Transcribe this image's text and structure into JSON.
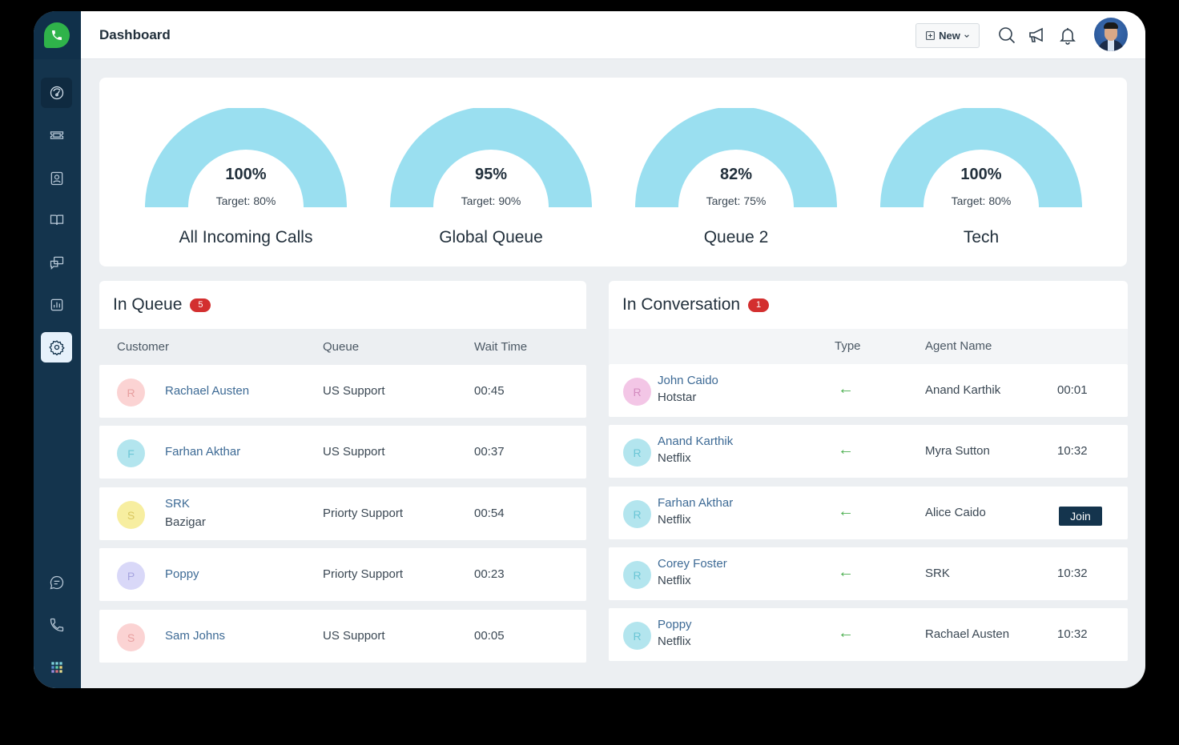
{
  "app": {
    "title": "Dashboard"
  },
  "colors": {
    "sidebar": "#14344d",
    "gauge_fill": "#9adff0",
    "badge": "#d32f2f",
    "accent_green": "#2fb34a",
    "link_text": "#3d6a95"
  },
  "sidebar": {
    "logo_icon": "phone-icon",
    "items": [
      {
        "id": "dashboard",
        "icon": "speedometer-icon",
        "active": "dark"
      },
      {
        "id": "tickets",
        "icon": "ticket-icon"
      },
      {
        "id": "contacts",
        "icon": "contact-card-icon"
      },
      {
        "id": "knowledge-base",
        "icon": "book-icon"
      },
      {
        "id": "conversations",
        "icon": "chat-windows-icon"
      },
      {
        "id": "reports",
        "icon": "bar-chart-icon"
      },
      {
        "id": "settings",
        "icon": "gear-icon",
        "active": "light"
      }
    ],
    "bottom_items": [
      {
        "id": "chat",
        "icon": "chat-bubble-icon"
      },
      {
        "id": "phone",
        "icon": "phone-icon"
      },
      {
        "id": "apps",
        "icon": "app-grid-icon"
      }
    ]
  },
  "topbar": {
    "new_label": "New",
    "icons": [
      "search-icon",
      "megaphone-icon",
      "bell-icon"
    ],
    "avatar": "user-avatar"
  },
  "gauges": [
    {
      "value": "100%",
      "target": "Target: 80%",
      "name": "All Incoming Calls"
    },
    {
      "value": "95%",
      "target": "Target: 90%",
      "name": "Global Queue"
    },
    {
      "value": "82%",
      "target": "Target: 75%",
      "name": "Queue 2"
    },
    {
      "value": "100%",
      "target": "Target: 80%",
      "name": "Tech"
    }
  ],
  "in_queue": {
    "title": "In Queue",
    "count": "5",
    "columns": [
      "Customer",
      "Queue",
      "Wait Time"
    ],
    "rows": [
      {
        "initial": "R",
        "name": "Rachael Austen",
        "sub": "",
        "queue": "US Support",
        "wait": "00:45",
        "color": "#fbd3d3",
        "text_color": "#e8a0a0"
      },
      {
        "initial": "F",
        "name": "Farhan Akthar",
        "sub": "",
        "queue": "US Support",
        "wait": "00:37",
        "color": "#b3e5ee",
        "text_color": "#6cc6d6"
      },
      {
        "initial": "S",
        "name": "SRK",
        "sub": "Bazigar",
        "queue": "Priorty Support",
        "wait": "00:54",
        "color": "#f7eea0",
        "text_color": "#d9c760"
      },
      {
        "initial": "P",
        "name": "Poppy",
        "sub": "",
        "queue": "Priorty Support",
        "wait": "00:23",
        "color": "#d9d8f8",
        "text_color": "#a7a5e0"
      },
      {
        "initial": "S",
        "name": "Sam Johns",
        "sub": "",
        "queue": "US Support",
        "wait": "00:05",
        "color": "#fbd3d3",
        "text_color": "#e8a0a0"
      }
    ]
  },
  "in_conversation": {
    "title": "In Conversation",
    "count": "1",
    "columns": [
      "",
      "Type",
      "Agent Name",
      ""
    ],
    "rows": [
      {
        "initial": "R",
        "name": "John Caido",
        "sub": "Hotstar",
        "type": "←",
        "agent": "Anand Karthik",
        "time": "00:01",
        "color": "#f3c6e6",
        "text_color": "#d48cc0"
      },
      {
        "initial": "R",
        "name": "Anand Karthik",
        "sub": "Netflix",
        "type": "←",
        "agent": "Myra Sutton",
        "time": "10:32",
        "color": "#b3e5ee",
        "text_color": "#6cc6d6"
      },
      {
        "initial": "R",
        "name": "Farhan Akthar",
        "sub": "Netflix",
        "type": "←",
        "agent": "Alice Caido",
        "time": "",
        "action": "Join",
        "color": "#b3e5ee",
        "text_color": "#6cc6d6"
      },
      {
        "initial": "R",
        "name": "Corey Foster",
        "sub": "Netflix",
        "type": "←",
        "agent": "SRK",
        "time": "10:32",
        "color": "#b3e5ee",
        "text_color": "#6cc6d6"
      },
      {
        "initial": "R",
        "name": "Poppy",
        "sub": "Netflix",
        "type": "←",
        "agent": "Rachael Austen",
        "time": "10:32",
        "color": "#b3e5ee",
        "text_color": "#6cc6d6"
      }
    ]
  }
}
